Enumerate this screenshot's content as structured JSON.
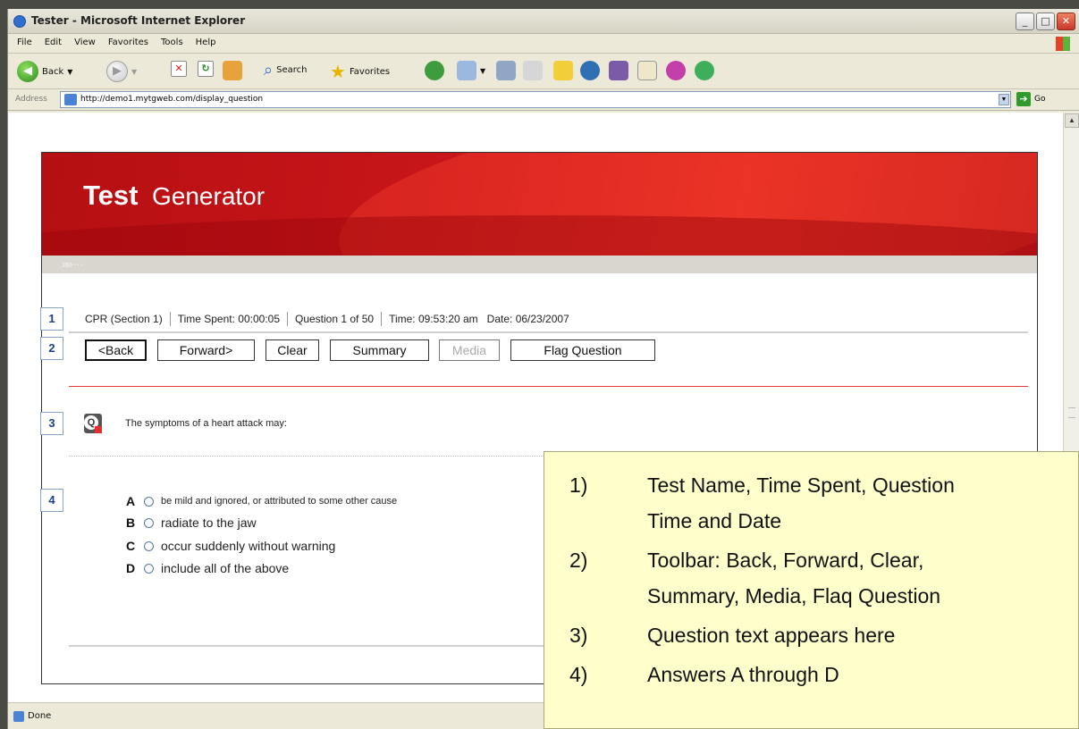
{
  "window": {
    "title": "Tester - Microsoft Internet Explorer",
    "controls": [
      "_",
      "□",
      "✕"
    ]
  },
  "menu": {
    "items": [
      "File",
      "Edit",
      "View",
      "Favorites",
      "Tools",
      "Help"
    ]
  },
  "toolbar": {
    "back": "Back",
    "search": "Search",
    "favorites": "Favorites"
  },
  "address": {
    "label": "Address",
    "url": "http://demo1.mytgweb.com/display_question",
    "go": "Go"
  },
  "status": {
    "text": "Done"
  },
  "page": {
    "logo_bold": "Test",
    "logo_light": "Generator",
    "chevrons": "»» · · ·",
    "section_numbers": [
      "1",
      "2",
      "3",
      "4"
    ],
    "info": {
      "test_name": "CPR (Section 1)",
      "time_spent": "Time Spent: 00:00:05",
      "question_count": "Question 1 of 50",
      "time": "Time: 09:53:20 am",
      "date": "Date: 06/23/2007"
    },
    "buttons": {
      "back": "<Back",
      "forward": "Forward>",
      "clear": "Clear",
      "summary": "Summary",
      "media": "Media",
      "flag": "Flag Question"
    },
    "question_icon": "Q",
    "question": "The symptoms of a heart attack may:",
    "answers": [
      {
        "letter": "A",
        "text": "be mild and ignored, or attributed to some other cause"
      },
      {
        "letter": "B",
        "text": "radiate to the jaw"
      },
      {
        "letter": "C",
        "text": "occur suddenly without warning"
      },
      {
        "letter": "D",
        "text": "include all of the above"
      }
    ]
  },
  "legend": {
    "items": [
      {
        "num": "1)",
        "line1": "Test Name, Time Spent, Question",
        "line2": "Time and Date"
      },
      {
        "num": "2)",
        "line1": "Toolbar: Back, Forward, Clear,",
        "line2": "Summary, Media, Flaq Question"
      },
      {
        "num": "3)",
        "line1": "Question text appears here"
      },
      {
        "num": "4)",
        "line1": "Answers A through D"
      }
    ]
  },
  "colors": {
    "header_red": "#c8161a",
    "number_blue": "#1b3f8c",
    "legend_bg": "#ffffcc"
  }
}
